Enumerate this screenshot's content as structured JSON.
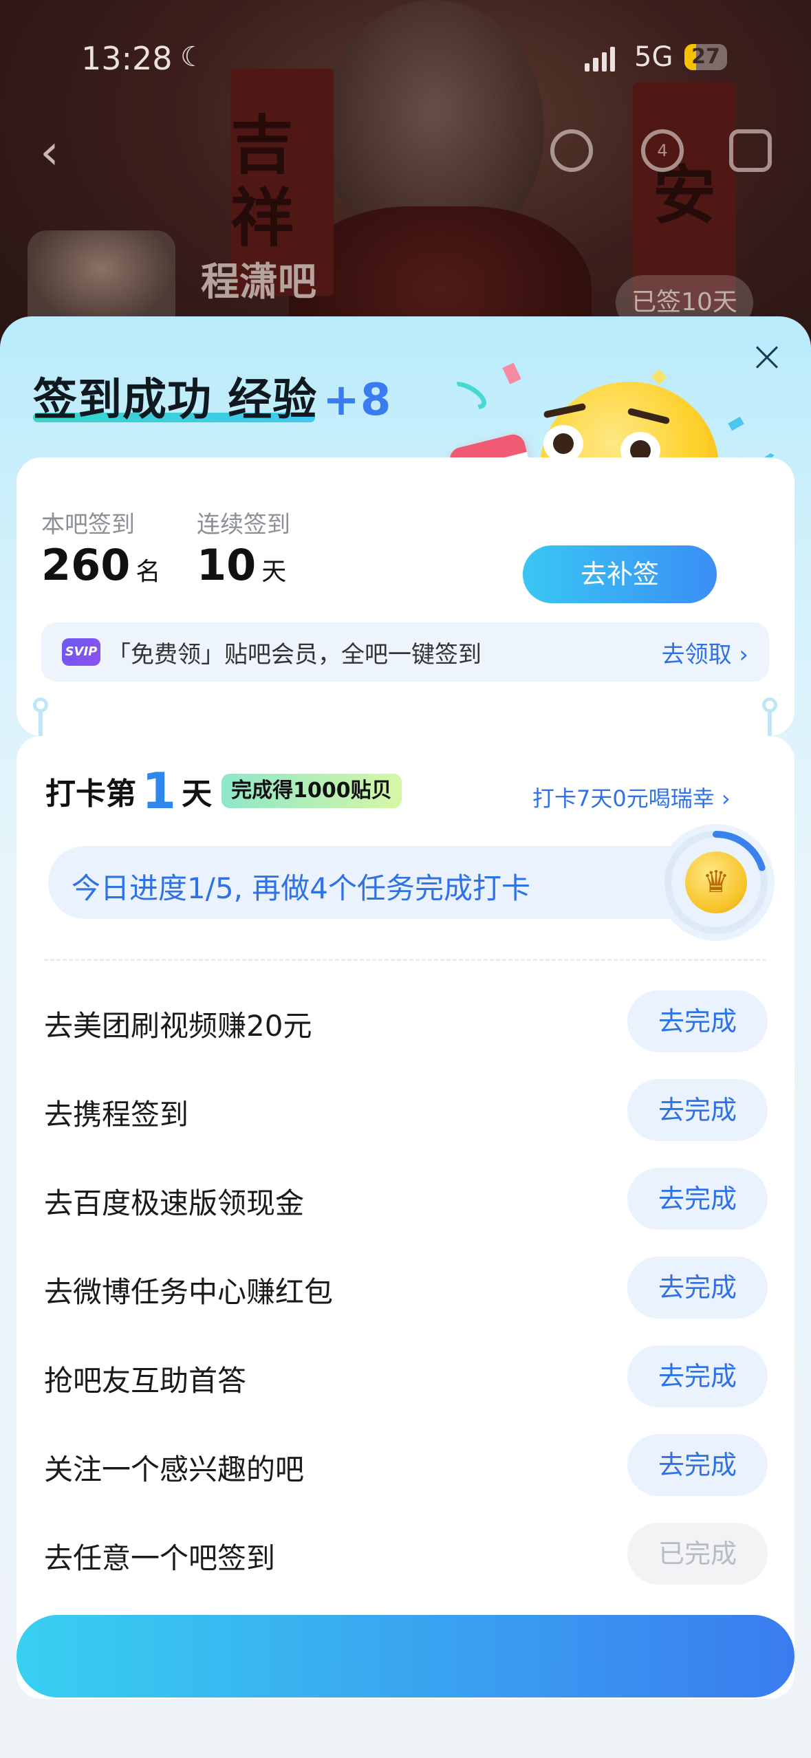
{
  "status_bar": {
    "time": "13:28",
    "network": "5G",
    "battery": "27",
    "battery_level": 0.27
  },
  "background": {
    "banner_left": "吉祥",
    "banner_right": "安",
    "forum_name": "程潇吧",
    "signed_badge": "已签10天",
    "message_badge": "4"
  },
  "sheet": {
    "title": "签到成功 经验",
    "exp_bonus": "+8",
    "stats": {
      "rank_label": "本吧签到",
      "rank_value": "260",
      "rank_unit": "名",
      "streak_label": "连续签到",
      "streak_value": "10",
      "streak_unit": "天"
    },
    "buqian_button": "去补签",
    "vip": {
      "icon_text": "SVIP",
      "text": "「免费领」贴吧会员，全吧一键签到",
      "link": "去领取 ›"
    },
    "checkin": {
      "prefix": "打卡第",
      "day": "1",
      "suffix": "天",
      "reward": "完成得1000贴贝",
      "link": "打卡7天0元喝瑞幸 ›",
      "progress_text": "今日进度1/5, 再做4个任务完成打卡",
      "progress_fraction": 0.2
    },
    "tasks": [
      {
        "name": "去美团刷视频赚20元",
        "action": "去完成",
        "done": false
      },
      {
        "name": "去携程签到",
        "action": "去完成",
        "done": false
      },
      {
        "name": "去百度极速版领现金",
        "action": "去完成",
        "done": false
      },
      {
        "name": "去微博任务中心赚红包",
        "action": "去完成",
        "done": false
      },
      {
        "name": "抢吧友互助首答",
        "action": "去完成",
        "done": false
      },
      {
        "name": "关注一个感兴趣的吧",
        "action": "去完成",
        "done": false
      },
      {
        "name": "去任意一个吧签到",
        "action": "已完成",
        "done": true
      }
    ]
  }
}
